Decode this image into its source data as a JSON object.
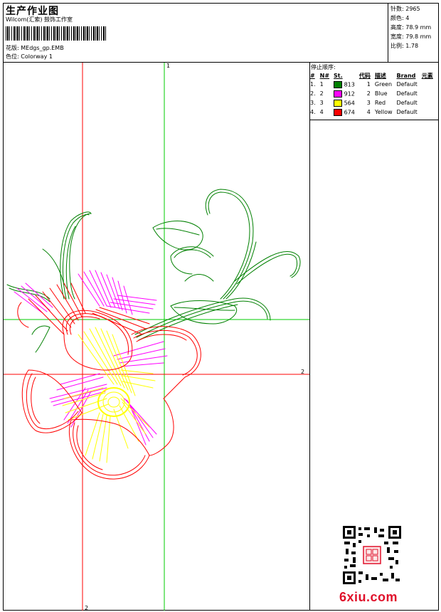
{
  "header": {
    "title": "生产作业图",
    "studio": "Wilcom(汇索) 鼓饰工作室",
    "design_label": "花版:",
    "design_value": "MEdgs_gp.EMB",
    "colorway_label": "色位:",
    "colorway_value": "Colorway 1"
  },
  "stats": [
    {
      "label": "针数:",
      "value": "2965"
    },
    {
      "label": "颜色:",
      "value": "4"
    },
    {
      "label": "高度:",
      "value": "78.9 mm"
    },
    {
      "label": "宽度:",
      "value": "79.8 mm"
    },
    {
      "label": "比例:",
      "value": "1.78"
    }
  ],
  "stop_sequence": {
    "title": "停止顺序:",
    "headers": [
      "#",
      "N#",
      "St.",
      "代码",
      "描述",
      "Brand",
      "元素"
    ],
    "rows": [
      {
        "num": "1.",
        "n": "1",
        "color": "#008000",
        "st": "813",
        "code": "1",
        "desc": "Green",
        "brand": "Default"
      },
      {
        "num": "2.",
        "n": "2",
        "color": "#ff00ff",
        "st": "912",
        "code": "2",
        "desc": "Blue",
        "brand": "Default"
      },
      {
        "num": "3.",
        "n": "3",
        "color": "#ffff00",
        "st": "564",
        "code": "3",
        "desc": "Red",
        "brand": "Default"
      },
      {
        "num": "4.",
        "n": "4",
        "color": "#ff0000",
        "st": "674",
        "code": "4",
        "desc": "Yellow",
        "brand": "Default"
      }
    ]
  },
  "guides": {
    "green_label_1": "1",
    "green_label_2": "2",
    "red_label_2_right": "2",
    "red_label_2_bottom": "2"
  },
  "colors": {
    "green": "#008000",
    "magenta": "#ff00ff",
    "yellow": "#ffff00",
    "red": "#ff0000",
    "guide_green": "#00cc00",
    "guide_red": "#ff0000"
  },
  "branding": {
    "logo_text": "6xiu.com"
  },
  "icons": {
    "qr": "qr-code-icon",
    "stamp": "seal-stamp-icon"
  }
}
